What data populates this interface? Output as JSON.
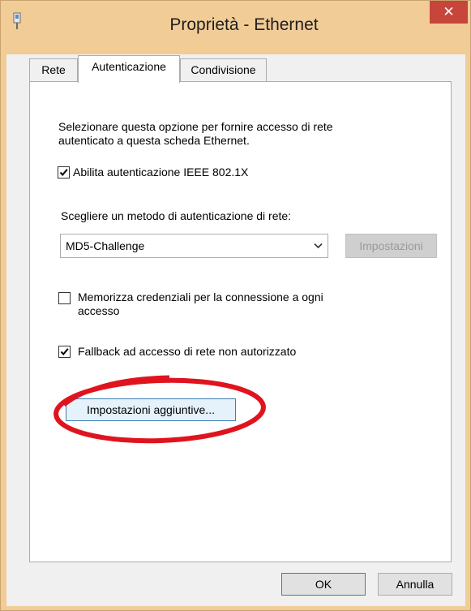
{
  "window": {
    "title": "Proprietà - Ethernet",
    "close_label": "✕"
  },
  "tabs": [
    {
      "label": "Rete",
      "active": false
    },
    {
      "label": "Autenticazione",
      "active": true
    },
    {
      "label": "Condivisione",
      "active": false
    }
  ],
  "auth": {
    "description_line1": "Selezionare questa opzione per fornire accesso di rete",
    "description_line2": "autenticato a questa scheda Ethernet.",
    "enable_8021x_label": "Abilita autenticazione IEEE 802.1X",
    "enable_8021x_checked": true,
    "method_label": "Scegliere un metodo di autenticazione di rete:",
    "method_selected": "MD5-Challenge",
    "settings_button_label": "Impostazioni",
    "remember_credentials_line1": "Memorizza credenziali per la connessione a ogni",
    "remember_credentials_line2": "accesso",
    "remember_credentials_checked": false,
    "fallback_label": "Fallback ad accesso di rete non autorizzato",
    "fallback_checked": true,
    "additional_settings_label": "Impostazioni aggiuntive..."
  },
  "footer": {
    "ok_label": "OK",
    "cancel_label": "Annulla"
  },
  "colors": {
    "title_bar": "#f1cc97",
    "close_button": "#c7453a",
    "highlight_ring": "#e0141e"
  }
}
